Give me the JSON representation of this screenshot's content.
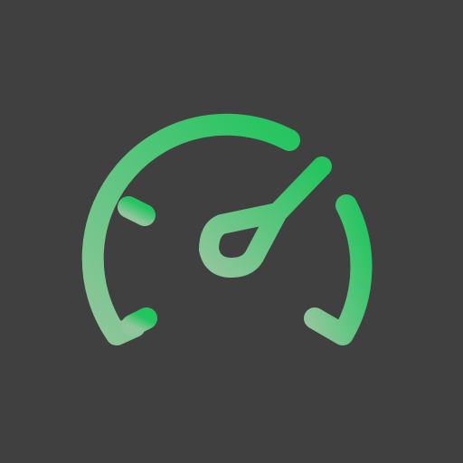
{
  "icon": {
    "name": "speedometer-icon",
    "background_color": "#404040",
    "gradient_start_color": "#8FC69B",
    "gradient_end_color": "#22C55E"
  }
}
